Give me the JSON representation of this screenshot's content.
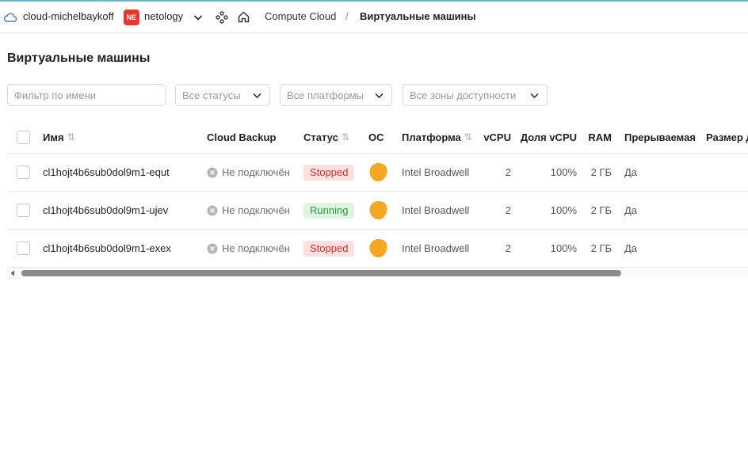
{
  "header": {
    "cloud_name": "cloud-michelbaykoff",
    "org_badge": "NE",
    "org_name": "netology",
    "breadcrumb": [
      "Compute Cloud",
      "/",
      "Виртуальные машины"
    ]
  },
  "page": {
    "title": "Виртуальные машины"
  },
  "filters": {
    "name_placeholder": "Фильтр по имени",
    "status": "Все статусы",
    "platform": "Все платформы",
    "zone": "Все зоны доступности"
  },
  "table": {
    "columns": {
      "name": "Имя",
      "backup": "Cloud Backup",
      "status": "Статус",
      "os": "ОС",
      "platform": "Платформа",
      "vcpu": "vCPU",
      "share": "Доля vCPU",
      "ram": "RAM",
      "preempt": "Прерываемая",
      "disk": "Размер д"
    },
    "sort_glyph": "⇅",
    "rows": [
      {
        "name": "cl1hojt4b6sub0dol9m1-equt",
        "backup": "Не подключён",
        "status": "Stopped",
        "os": "LAMP",
        "platform": "Intel Broadwell",
        "vcpu": "2",
        "share": "100%",
        "ram": "2 ГБ",
        "preempt": "Да"
      },
      {
        "name": "cl1hojt4b6sub0dol9m1-ujev",
        "backup": "Не подключён",
        "status": "Running",
        "os": "LAMP",
        "platform": "Intel Broadwell",
        "vcpu": "2",
        "share": "100%",
        "ram": "2 ГБ",
        "preempt": "Да"
      },
      {
        "name": "cl1hojt4b6sub0dol9m1-exex",
        "backup": "Не подключён",
        "status": "Stopped",
        "os": "LAMP",
        "platform": "Intel Broadwell",
        "vcpu": "2",
        "share": "100%",
        "ram": "2 ГБ",
        "preempt": "Да"
      }
    ]
  },
  "colors": {
    "stopped_bg": "#fde0df",
    "stopped_text": "#d33030",
    "running_bg": "#dff4e2",
    "running_text": "#2e9c3c",
    "org_badge": "#e03a2e",
    "lamp": "#f5a623"
  },
  "icons": [
    "cloud-icon",
    "chevron-down-icon",
    "services-icon",
    "home-icon",
    "not-connected-icon",
    "lamp-os-icon",
    "scroll-left-icon"
  ]
}
